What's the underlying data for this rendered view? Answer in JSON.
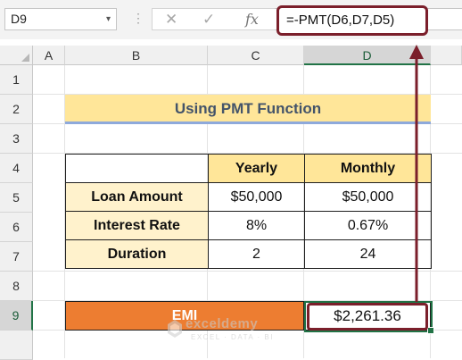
{
  "formula_bar": {
    "name_box": "D9",
    "name_box_dropdown": "▾",
    "dots": "⋮",
    "cancel_glyph": "✕",
    "enter_glyph": "✓",
    "fx_label": "fx",
    "formula": "=-PMT(D6,D7,D5)"
  },
  "columns": [
    "A",
    "B",
    "C",
    "D"
  ],
  "rows": [
    "1",
    "2",
    "3",
    "4",
    "5",
    "6",
    "7",
    "8",
    "9"
  ],
  "selection": {
    "column": "D",
    "row": "9",
    "color": "#217346"
  },
  "sheet": {
    "title": "Using PMT Function",
    "table": {
      "headers": [
        "",
        "Yearly",
        "Monthly"
      ],
      "rows": [
        {
          "label": "Loan Amount",
          "yearly": "$50,000",
          "monthly": "$50,000"
        },
        {
          "label": "Interest Rate",
          "yearly": "8%",
          "monthly": "0.67%"
        },
        {
          "label": "Duration",
          "yearly": "2",
          "monthly": "24"
        }
      ]
    },
    "emi": {
      "label": "EMI",
      "value": "$2,261.36"
    }
  },
  "watermark": {
    "name": "exceldemy",
    "tagline": "EXCEL · DATA · BI"
  },
  "colors": {
    "header_fill": "#ffe699",
    "label_fill": "#fff2cc",
    "emi_fill": "#ed7d31",
    "annotation": "#7b1f2b",
    "title_text": "#44546a"
  }
}
